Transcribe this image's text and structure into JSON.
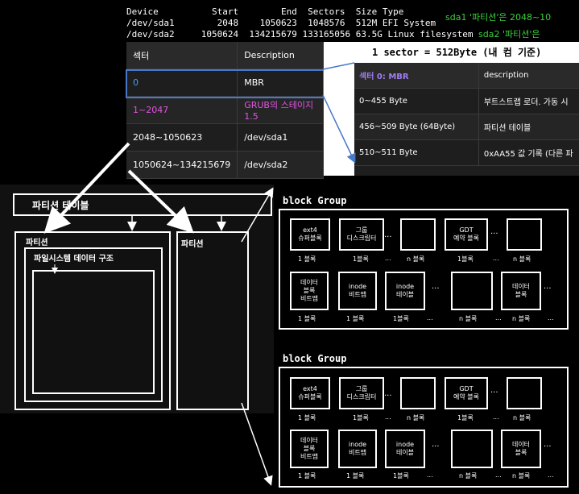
{
  "terminal": {
    "header": "Device          Start        End  Sectors  Size Type",
    "row1": "/dev/sda1        2048    1050623  1048576  512M EFI System",
    "row2": "/dev/sda2     1050624  134215679 133165056 63.5G Linux filesystem",
    "note1": "sda1 '파티션'은 2048~10",
    "note2": "sda2 '파티션'은"
  },
  "sector_table": {
    "headers": [
      "섹터",
      "Description"
    ],
    "rows": [
      [
        "0",
        "MBR"
      ],
      [
        "1~2047",
        "GRUB의 스테이지 1.5"
      ],
      [
        "2048~1050623",
        "/dev/sda1"
      ],
      [
        "1050624~134215679",
        "/dev/sda2"
      ]
    ]
  },
  "sector_note": "1 sector = 512Byte (내 컴 기준)",
  "mbr_table": {
    "headers": [
      "섹터 0: MBR",
      "description"
    ],
    "rows": [
      [
        "0~455 Byte",
        "부트스트랩 로더. 가동 시"
      ],
      [
        "456~509 Byte (64Byte)",
        "파티션 테이블"
      ],
      [
        "510~511 Byte",
        "0xAA55 값 기록 (다른 파"
      ]
    ]
  },
  "diagram": {
    "partition_table": "파티션 테이블",
    "partition1": "파티션",
    "fs_struct": "파일시스템 데이터 구조",
    "partition2": "파티션"
  },
  "groups": [
    {
      "title": "block Group",
      "row1": [
        "ext4\n슈퍼블록",
        "그룹\n디스크립터",
        "",
        "GDT\n예약 블록",
        ""
      ],
      "row1_labels": [
        "1 블록",
        "1블록",
        "n 블록",
        "1블록",
        "n 블록"
      ],
      "row2": [
        "데이터\n블록\n비트맵",
        "inode\n비트맵",
        "inode\n테이블",
        "",
        "데이터\n블록"
      ],
      "row2_labels": [
        "1 블록",
        "1 블록",
        "1블록",
        "n 블록",
        "n 블록"
      ]
    },
    {
      "title": "block Group",
      "row1": [
        "ext4\n슈퍼블록",
        "그룹\n디스크립터",
        "",
        "GDT\n예약 블록",
        ""
      ],
      "row1_labels": [
        "1 블록",
        "1블록",
        "n 블록",
        "1블록",
        "n 블록"
      ],
      "row2": [
        "데이터\n블록\n비트맵",
        "inode\n비트맵",
        "inode\n테이블",
        "",
        "데이터\n블록"
      ],
      "row2_labels": [
        "1 블록",
        "1 블록",
        "1블록",
        "n 블록",
        "n 블록"
      ]
    }
  ],
  "ellipsis": "...",
  "colors": {
    "green": "#3bd13b",
    "magenta": "#e056e0",
    "blue": "#4a78c8",
    "purple": "#a07cf0"
  }
}
